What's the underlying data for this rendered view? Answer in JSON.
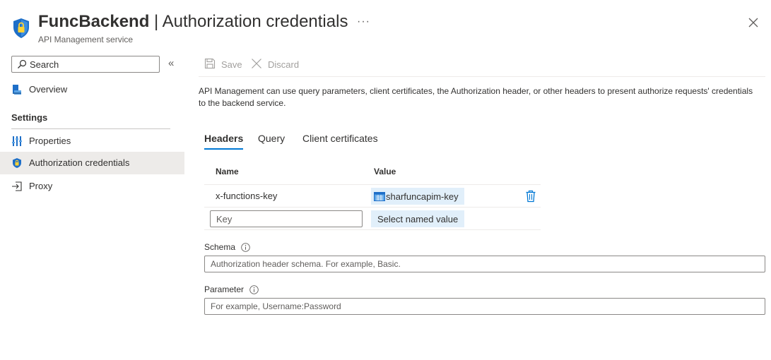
{
  "header": {
    "resource_name": "FuncBackend",
    "separator": " | ",
    "page_title": "Authorization credentials",
    "subtitle": "API Management service",
    "more_label": "···"
  },
  "sidebar": {
    "search_placeholder": "Search",
    "collapse_glyph": "«",
    "items": [
      {
        "label": "Overview",
        "icon": "overview-icon"
      },
      {
        "label": "Properties",
        "icon": "properties-icon"
      },
      {
        "label": "Authorization credentials",
        "icon": "shield-icon",
        "active": true
      },
      {
        "label": "Proxy",
        "icon": "proxy-icon"
      }
    ],
    "section_heading": "Settings"
  },
  "toolbar": {
    "save_label": "Save",
    "discard_label": "Discard"
  },
  "description": "API Management can use query parameters, client certificates, the Authorization header, or other headers to present authorize requests' credentials to the backend service.",
  "tabs": [
    {
      "label": "Headers",
      "active": true
    },
    {
      "label": "Query",
      "active": false
    },
    {
      "label": "Client certificates",
      "active": false
    }
  ],
  "headers_table": {
    "columns": [
      "Name",
      "Value"
    ],
    "rows": [
      {
        "name": "x-functions-key",
        "value": "sharfuncapim-key"
      }
    ],
    "new_key_placeholder": "Key",
    "select_named_value_label": "Select named value"
  },
  "schema": {
    "label": "Schema",
    "placeholder": "Authorization header schema. For example, Basic."
  },
  "parameter": {
    "label": "Parameter",
    "placeholder": "For example, Username:Password"
  },
  "colors": {
    "accent": "#0078d4",
    "chip_bg": "#e1effa",
    "nav_active_bg": "#edebe9"
  }
}
